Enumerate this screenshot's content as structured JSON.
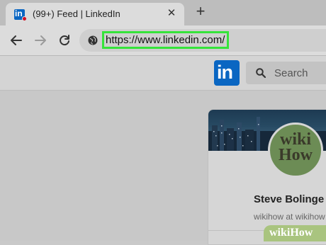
{
  "browser": {
    "tab": {
      "title": "(99+) Feed | LinkedIn",
      "favicon_text": "in",
      "close_glyph": "✕"
    },
    "new_tab_glyph": "+",
    "toolbar": {
      "back_icon": "arrow-left-icon",
      "forward_icon": "arrow-right-icon",
      "reload_icon": "reload-icon",
      "site_info_icon": "globe-icon",
      "url": "https://www.linkedin.com/"
    },
    "highlight_color": "#35e43a"
  },
  "linkedin": {
    "logo_text": "in",
    "brand_color": "#0a66c2",
    "search_placeholder": "Search",
    "profile": {
      "name": "Steve Bolinge",
      "headline": "wikihow at wikihow"
    }
  },
  "watermark": {
    "avatar_text_1": "wiki",
    "avatar_text_2": "How",
    "corner_text": "wikiHow"
  }
}
